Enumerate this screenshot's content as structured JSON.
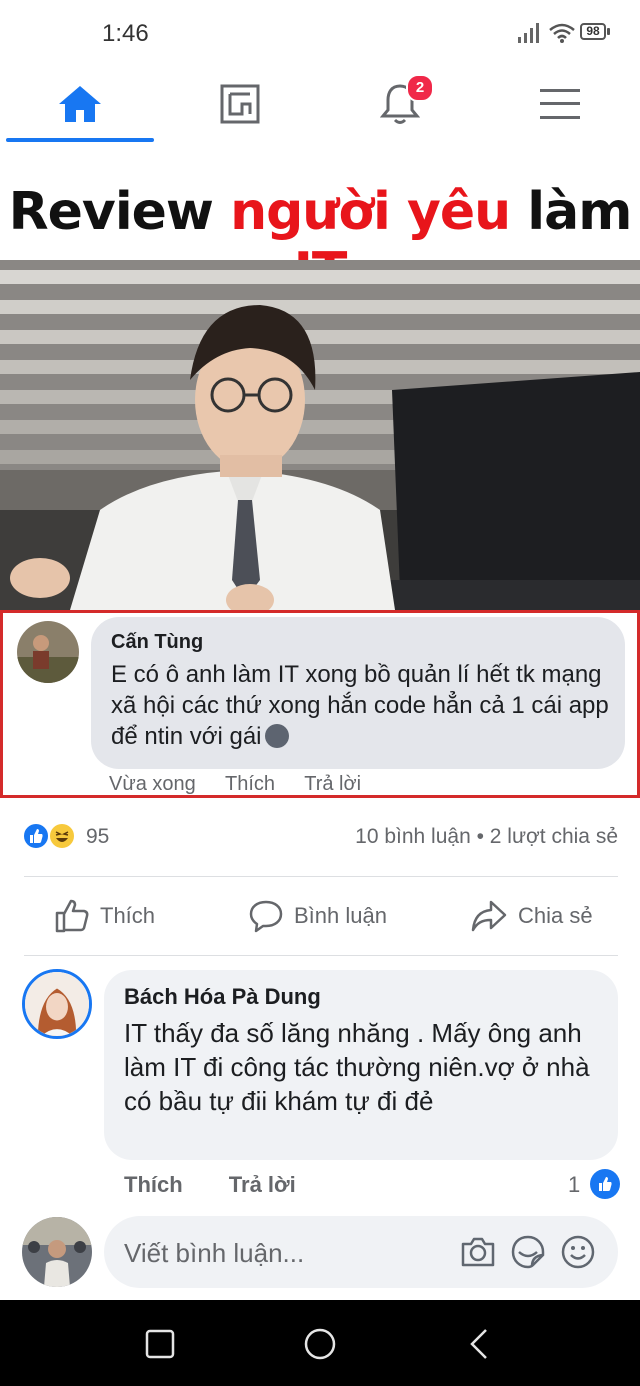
{
  "status_bar": {
    "time": "1:46",
    "battery": "98"
  },
  "nav": {
    "notification_count": "2"
  },
  "post": {
    "meme_title_part1": "Review ",
    "meme_title_part2": "người yêu",
    "meme_title_part3": " làm ",
    "meme_title_part4": "IT",
    "embedded_comment": {
      "author": "Cấn Tùng",
      "text": "E có ô anh làm IT xong bồ quản lí hết tk mạng xã hội các thứ xong hắn code hẳn cả 1 cái app để ntin với gái",
      "actions": [
        "Vừa xong",
        "Thích",
        "Trả lời"
      ]
    },
    "reaction_count": "95",
    "stats": "10 bình luận • 2 lượt chia sẻ",
    "actions": {
      "like": "Thích",
      "comment": "Bình luận",
      "share": "Chia sẻ"
    }
  },
  "comment": {
    "author": "Bách Hóa Pà Dung",
    "text": "IT thấy đa số lăng nhăng . Mấy ông anh làm IT đi công tác thường niên.vợ ở nhà có bầu tự đii khám tự đi đẻ",
    "like_label": "Thích",
    "reply_label": "Trả lời",
    "like_count": "1"
  },
  "composer": {
    "placeholder": "Viết bình luận..."
  },
  "colors": {
    "brand": "#1877f2",
    "badge": "#f02849",
    "highlight_border": "#d42a2a",
    "meme_red": "#e8151b"
  }
}
